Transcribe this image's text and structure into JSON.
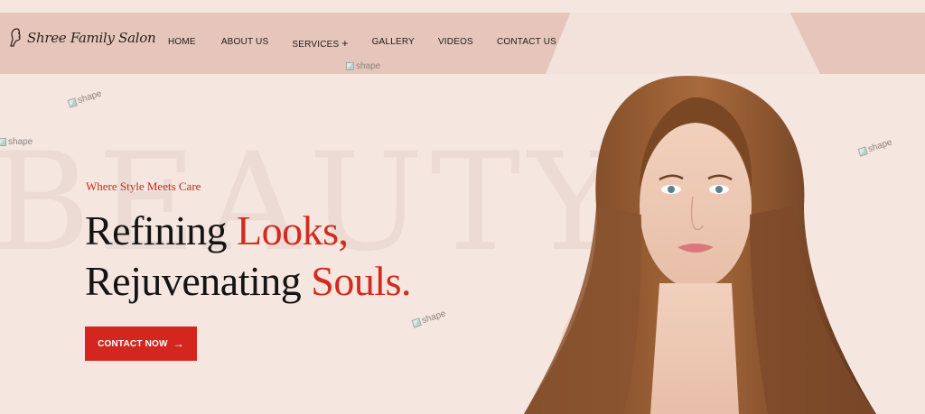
{
  "brand": {
    "logo_text": "Shree Family Salon",
    "logo_icon": "woman-profile-icon"
  },
  "nav": {
    "items": [
      {
        "label": "HOME"
      },
      {
        "label": "ABOUT US"
      },
      {
        "label": "SERVICES",
        "suffix": "+"
      },
      {
        "label": "GALLERY"
      },
      {
        "label": "VIDEOS"
      },
      {
        "label": "CONTACT US"
      }
    ]
  },
  "placeholders": {
    "shape_alt": "shape"
  },
  "hero": {
    "background_word": "BEAUTY",
    "tagline": "Where Style Meets Care",
    "headline_line1_main": "Refining ",
    "headline_line1_accent": "Looks,",
    "headline_line2_main": "Rejuvenating ",
    "headline_line2_accent": "Souls.",
    "cta_label": "CONTACT NOW",
    "cta_icon": "arrow-right-icon"
  },
  "colors": {
    "accent": "#d3261e",
    "header_band": "#e6c6bb",
    "background": "#f5e6df"
  }
}
